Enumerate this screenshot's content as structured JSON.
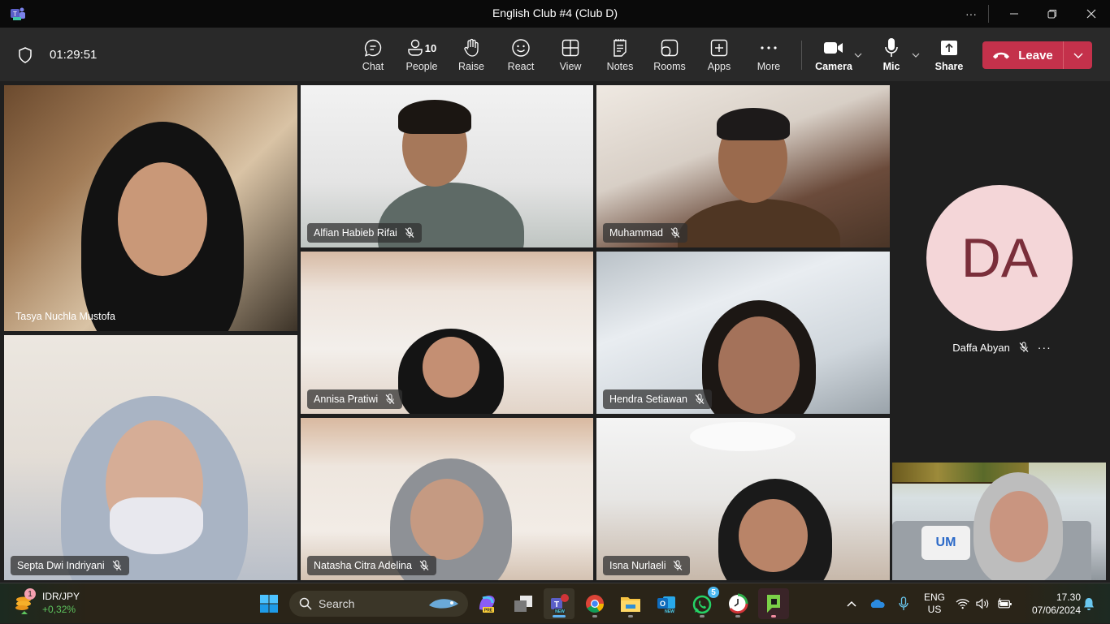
{
  "window": {
    "title": "English Club #4 (Club D)",
    "app_icon": "teams-icon",
    "controls": [
      "more-options-icon",
      "minimize-icon",
      "restore-icon",
      "close-icon"
    ]
  },
  "toolbar": {
    "timer": "01:29:51",
    "buttons": [
      {
        "id": "chat",
        "label": "Chat",
        "icon": "chat-icon"
      },
      {
        "id": "people",
        "label": "People",
        "icon": "people-icon",
        "count": "10"
      },
      {
        "id": "raise",
        "label": "Raise",
        "icon": "hand-icon"
      },
      {
        "id": "react",
        "label": "React",
        "icon": "smiley-icon"
      },
      {
        "id": "view",
        "label": "View",
        "icon": "grid-icon"
      },
      {
        "id": "notes",
        "label": "Notes",
        "icon": "notes-icon"
      },
      {
        "id": "rooms",
        "label": "Rooms",
        "icon": "rooms-icon"
      },
      {
        "id": "apps",
        "label": "Apps",
        "icon": "plus-square-icon"
      },
      {
        "id": "more",
        "label": "More",
        "icon": "ellipsis-icon"
      },
      {
        "id": "camera",
        "label": "Camera",
        "icon": "camera-icon"
      },
      {
        "id": "mic",
        "label": "Mic",
        "icon": "mic-icon"
      },
      {
        "id": "share",
        "label": "Share",
        "icon": "share-icon"
      }
    ],
    "leave_label": "Leave",
    "leave_color": "#c4314b"
  },
  "participants": [
    {
      "name": "Tasya Nuchla Mustofa",
      "muted": false
    },
    {
      "name": "Alfian Habieb Rifai",
      "muted": true
    },
    {
      "name": "Muhammad",
      "muted": true
    },
    {
      "name": "Annisa Pratiwi",
      "muted": true
    },
    {
      "name": "Hendra Setiawan",
      "muted": true
    },
    {
      "name": "Septa Dwi Indriyani",
      "muted": true
    },
    {
      "name": "Natasha Citra Adelina",
      "muted": true
    },
    {
      "name": "Isna Nurlaeli",
      "muted": true
    }
  ],
  "avatar_participant": {
    "initials": "DA",
    "name": "Daffa Abyan",
    "muted": true,
    "avatar_bg": "#f4d6d8",
    "avatar_fg": "#7a2e3a"
  },
  "self_view": {
    "pillow_text": "UM"
  },
  "taskbar": {
    "widget": {
      "symbol": "IDR/JPY",
      "change": "+0,32%",
      "badge": "1"
    },
    "search_label": "Search",
    "apps": [
      {
        "name": "copilot",
        "tag": "PRE"
      },
      {
        "name": "task-view"
      },
      {
        "name": "teams",
        "tag": "NEW",
        "active": true
      },
      {
        "name": "chrome"
      },
      {
        "name": "file-explorer"
      },
      {
        "name": "outlook",
        "tag": "NEW"
      },
      {
        "name": "whatsapp",
        "badge": "5"
      },
      {
        "name": "clock-app"
      },
      {
        "name": "green-app"
      }
    ],
    "tray": {
      "lang_line1": "ENG",
      "lang_line2": "US",
      "time": "17.30",
      "date": "07/06/2024"
    }
  }
}
